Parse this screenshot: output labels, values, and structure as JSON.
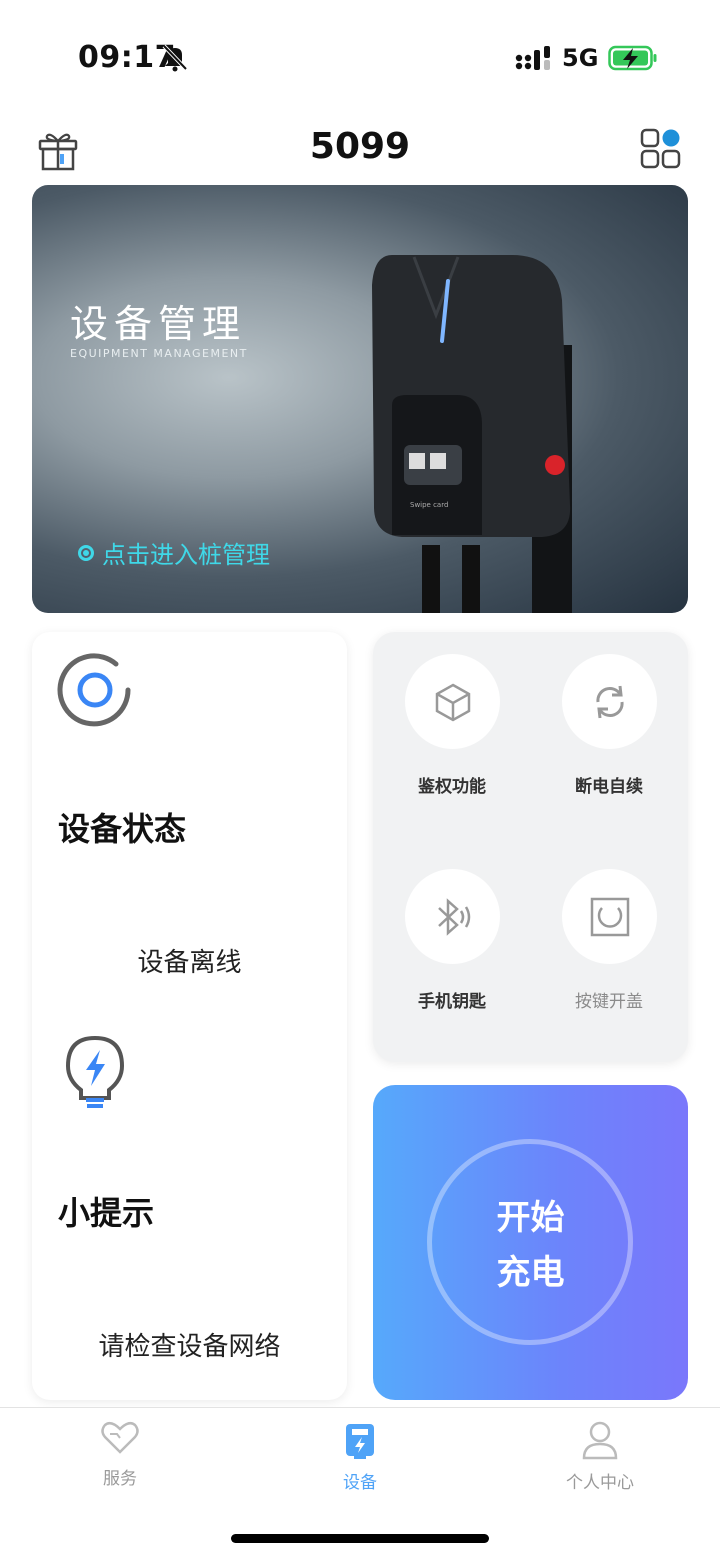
{
  "status_bar": {
    "time": "09:17",
    "network": "5G"
  },
  "header": {
    "title": "5099"
  },
  "banner": {
    "title": "设备管理",
    "subtitle": "EQUIPMENT MANAGEMENT",
    "link": "点击进入桩管理",
    "charger_qr_caption": "Swipe card"
  },
  "status_card": {
    "heading": "设备状态",
    "value": "设备离线",
    "tip_heading": "小提示",
    "tip_value": "请检查设备网络"
  },
  "functions": [
    {
      "label": "鉴权功能",
      "icon": "cube-icon"
    },
    {
      "label": "断电自续",
      "icon": "refresh-icon"
    },
    {
      "label": "手机钥匙",
      "icon": "bluetooth-icon"
    },
    {
      "label": "按键开盖",
      "icon": "lid-icon"
    }
  ],
  "charge": {
    "line1": "开始",
    "line2": "充电"
  },
  "tabs": [
    {
      "label": "服务",
      "icon": "heart-icon",
      "active": false
    },
    {
      "label": "设备",
      "icon": "charger-icon",
      "active": true
    },
    {
      "label": "个人中心",
      "icon": "person-icon",
      "active": false
    }
  ],
  "colors": {
    "accent": "#4fa3f7",
    "link": "#3fd8e8",
    "charge_start": "#56a9fb",
    "charge_end": "#7a77fb"
  }
}
